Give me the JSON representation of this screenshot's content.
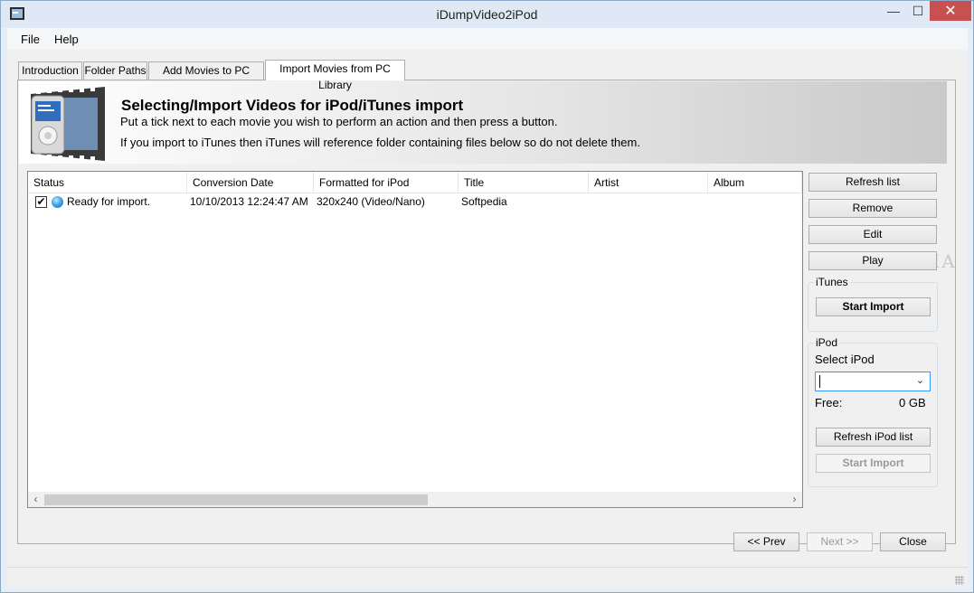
{
  "window": {
    "title": "iDumpVideo2iPod",
    "min_glyph": "—",
    "max_glyph": "☐",
    "close_glyph": "✕"
  },
  "menu": [
    "File",
    "Help"
  ],
  "tabs": [
    "Introduction",
    "Folder Paths",
    "Add Movies to PC Library",
    "Import Movies from PC Library"
  ],
  "active_tab": 3,
  "banner": {
    "title": "Selecting/Import Videos for iPod/iTunes import",
    "line1": "Put a tick next to each movie you wish to perform an action and then press a button.",
    "line2": "If you import to iTunes then iTunes will reference folder containing files below so do not delete them."
  },
  "list": {
    "columns": [
      "Status",
      "Conversion Date",
      "Formatted for iPod",
      "Title",
      "Artist",
      "Album"
    ],
    "rows": [
      {
        "checked": true,
        "status": "Ready for import.",
        "conversion_date": "10/10/2013 12:24:47 AM",
        "format": "320x240 (Video/Nano)",
        "title": "Softpedia",
        "artist": "",
        "album": ""
      }
    ],
    "scroll_left_glyph": "‹",
    "scroll_right_glyph": "›"
  },
  "watermark": "SOFTPEDIA",
  "actions": {
    "refresh": "Refresh list",
    "remove": "Remove",
    "edit": "Edit",
    "play": "Play"
  },
  "itunes": {
    "group_label": "iTunes",
    "start_import": "Start Import"
  },
  "ipod": {
    "group_label": "iPod",
    "select_label": "Select iPod",
    "selected_value": "",
    "free_label": "Free:",
    "free_value": "0 GB",
    "refresh": "Refresh iPod list",
    "start_import": "Start Import"
  },
  "nav": {
    "prev": "<< Prev",
    "next": "Next >>",
    "close": "Close"
  },
  "icons": [
    "app-icon",
    "checkbox-check-icon",
    "status-globe-icon",
    "chevron-down-icon",
    "size-grip-icon"
  ]
}
